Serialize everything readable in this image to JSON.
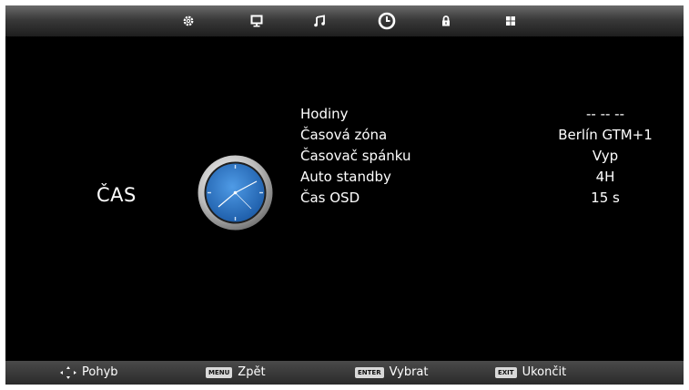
{
  "menu": {
    "tabs": [
      {
        "icon": "gear-icon",
        "active": false
      },
      {
        "icon": "monitor-icon",
        "active": false
      },
      {
        "icon": "music-note-icon",
        "active": false
      },
      {
        "icon": "clock-icon",
        "active": true
      },
      {
        "icon": "lock-icon",
        "active": false
      },
      {
        "icon": "grid-icon",
        "active": false
      }
    ]
  },
  "page": {
    "title": "ČAS",
    "icon": "clock-icon"
  },
  "settings": [
    {
      "label": "Hodiny",
      "value": "-- -- --"
    },
    {
      "label": "Časová zóna",
      "value": "Berlín GTM+1"
    },
    {
      "label": "Časovač spánku",
      "value": "Vyp"
    },
    {
      "label": "Auto standby",
      "value": "4H"
    },
    {
      "label": "Čas OSD",
      "value": "15 s"
    }
  ],
  "footer": {
    "move": {
      "icon": "navigation-arrows-icon",
      "label": "Pohyb"
    },
    "back": {
      "key": "MENU",
      "label": "Zpět"
    },
    "select": {
      "key": "ENTER",
      "label": "Vybrat"
    },
    "exit": {
      "key": "EXIT",
      "label": "Ukončit"
    }
  },
  "colors": {
    "background": "#000000",
    "text": "#ffffff",
    "clock_face": "#2a75c8"
  }
}
